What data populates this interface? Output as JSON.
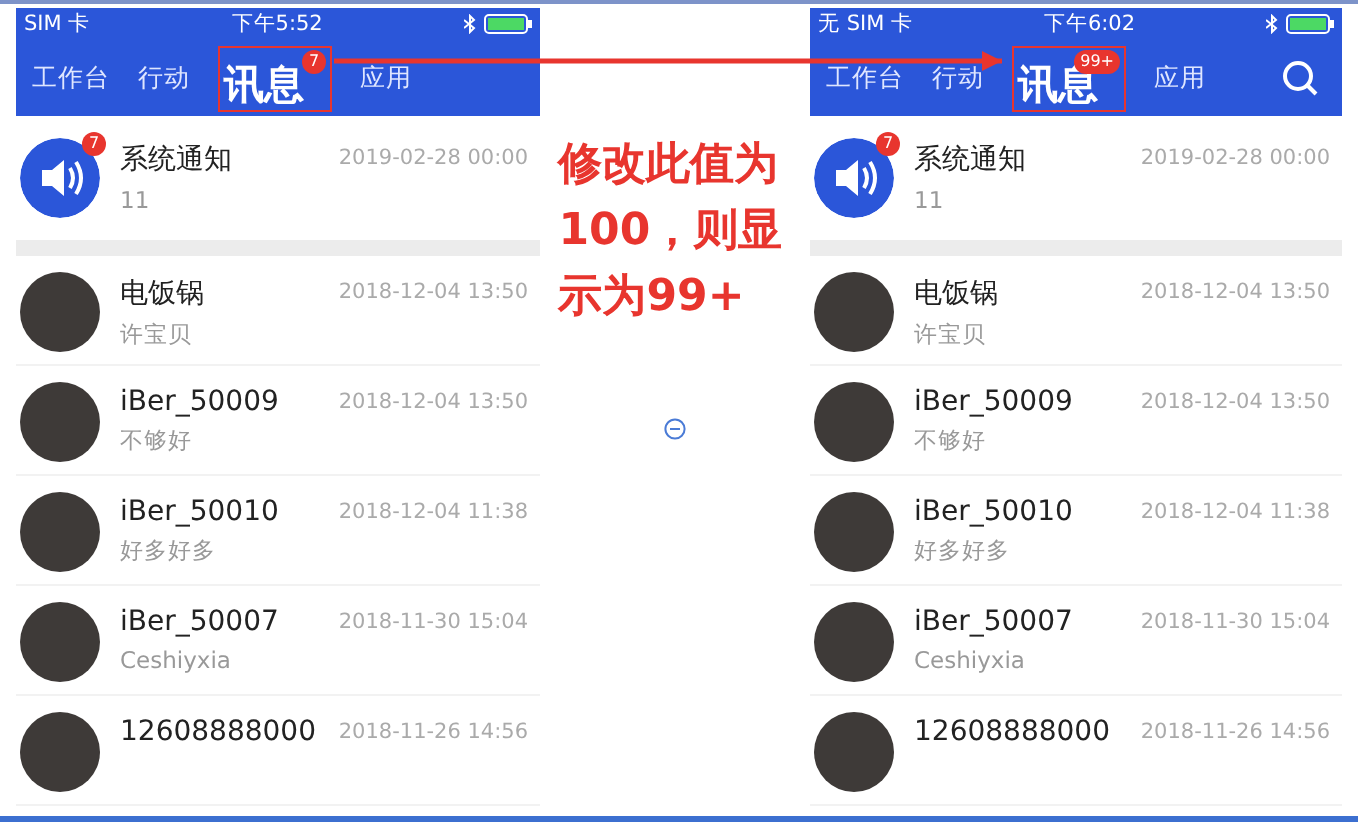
{
  "panels": [
    {
      "status_bar": {
        "carrier": "SIM 卡",
        "time": "下午5:52"
      },
      "tabs": [
        {
          "label": "工作台",
          "selected": false
        },
        {
          "label": "行动",
          "selected": false
        },
        {
          "label": "讯息",
          "selected": true,
          "badge": "7"
        },
        {
          "label": "应用",
          "selected": false
        }
      ],
      "search_icon": false,
      "items": [
        {
          "kind": "system",
          "title": "系统通知",
          "subtitle": "11",
          "time": "2019-02-28 00:00",
          "badge": "7"
        },
        {
          "kind": "contact",
          "title": "电饭锅",
          "subtitle": "许宝贝",
          "time": "2018-12-04 13:50"
        },
        {
          "kind": "contact",
          "title": "iBer_50009",
          "subtitle": "不够好",
          "time": "2018-12-04 13:50"
        },
        {
          "kind": "contact",
          "title": "iBer_50010",
          "subtitle": "好多好多",
          "time": "2018-12-04 11:38"
        },
        {
          "kind": "contact",
          "title": "iBer_50007",
          "subtitle": "Ceshiyxia",
          "time": "2018-11-30 15:04"
        },
        {
          "kind": "contact",
          "title": "12608888000",
          "time": "2018-11-26 14:56"
        }
      ]
    },
    {
      "status_bar": {
        "carrier": "无 SIM 卡",
        "time": "下午6:02"
      },
      "tabs": [
        {
          "label": "工作台",
          "selected": false
        },
        {
          "label": "行动",
          "selected": false
        },
        {
          "label": "讯息",
          "selected": true,
          "badge": "99+"
        },
        {
          "label": "应用",
          "selected": false
        }
      ],
      "search_icon": true,
      "items": [
        {
          "kind": "system",
          "title": "系统通知",
          "subtitle": "11",
          "time": "2019-02-28 00:00",
          "badge": "7"
        },
        {
          "kind": "contact",
          "title": "电饭锅",
          "subtitle": "许宝贝",
          "time": "2018-12-04 13:50"
        },
        {
          "kind": "contact",
          "title": "iBer_50009",
          "subtitle": "不够好",
          "time": "2018-12-04 13:50"
        },
        {
          "kind": "contact",
          "title": "iBer_50010",
          "subtitle": "好多好多",
          "time": "2018-12-04 11:38"
        },
        {
          "kind": "contact",
          "title": "iBer_50007",
          "subtitle": "Ceshiyxia",
          "time": "2018-11-30 15:04"
        },
        {
          "kind": "contact",
          "title": "12608888000",
          "time": "2018-11-26 14:56"
        }
      ]
    }
  ],
  "annotation": {
    "text": "修改此值为100，则显示为99+"
  }
}
